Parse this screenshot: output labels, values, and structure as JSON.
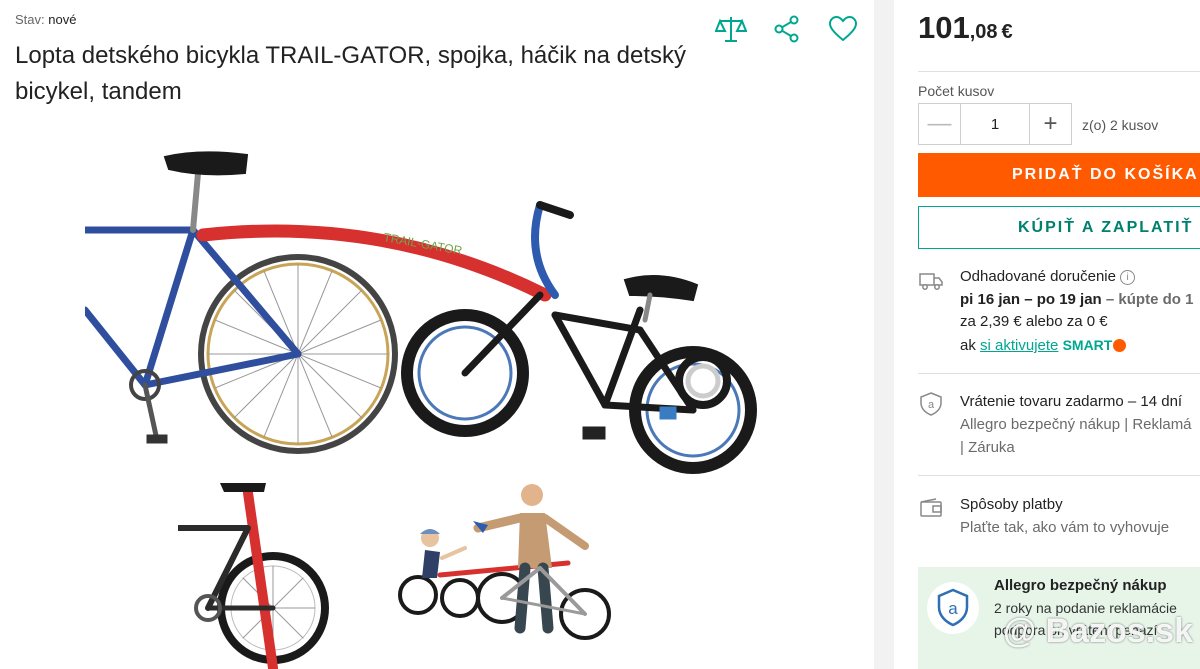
{
  "product": {
    "state_label": "Stav:",
    "state_value": "nové",
    "title": "Lopta detského bicykla TRAIL-GATOR, spojka, háčik na detský bicykel, tandem"
  },
  "actions": {
    "compare_icon": "scale-icon",
    "share_icon": "share-icon",
    "favorite_icon": "heart-icon"
  },
  "price": {
    "whole": "101",
    "cents": ",08",
    "currency": "€"
  },
  "quantity": {
    "label": "Počet kusov",
    "value": "1",
    "of_text": "z(o) 2 kusov"
  },
  "buttons": {
    "add_to_cart": "PRIDAŤ DO KOŠÍKA",
    "buy_now": "KÚPIŤ A ZAPLATIŤ"
  },
  "delivery": {
    "title": "Odhadované doručenie",
    "dates": "pi 16 jan – po 19 jan",
    "buy_suffix": "– kúpte do 1",
    "cost": "za 2,39 € alebo za 0 €",
    "activate_prefix": "ak",
    "activate_link": "si aktivujete",
    "smart": "SMART"
  },
  "returns": {
    "title": "Vrátenie tovaru zadarmo – 14 dní",
    "line2": "Allegro bezpečný nákup | Reklamá",
    "line3": "| Záruka"
  },
  "payment": {
    "title": "Spôsoby platby",
    "subtitle": "Plaťte tak, ako vám to vyhovuje"
  },
  "safe": {
    "title": "Allegro bezpečný nákup",
    "line1": "2 roky na podanie reklamácie",
    "line2": "podpora pri vrátení peňazí"
  },
  "watermark": "@ Bazos.sk",
  "colors": {
    "accent_orange": "#ff5a00",
    "accent_teal": "#00a790"
  }
}
